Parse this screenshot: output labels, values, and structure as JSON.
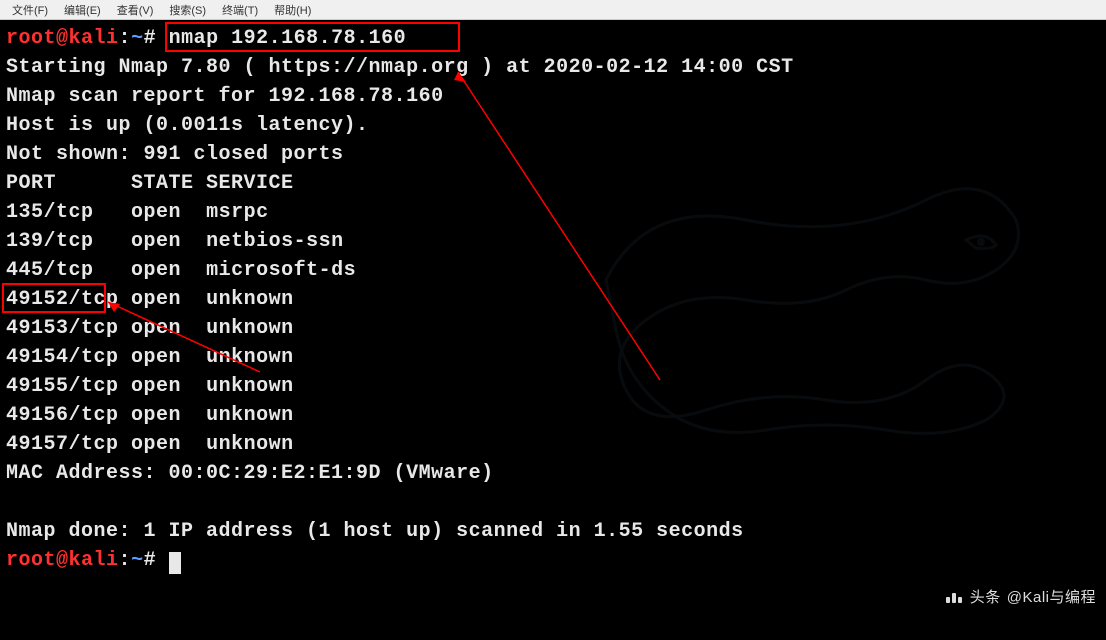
{
  "menubar": {
    "items": [
      {
        "label": "文件(F)"
      },
      {
        "label": "编辑(E)"
      },
      {
        "label": "查看(V)"
      },
      {
        "label": "搜索(S)"
      },
      {
        "label": "终端(T)"
      },
      {
        "label": "帮助(H)"
      }
    ]
  },
  "prompt": {
    "user": "root",
    "at": "@",
    "host": "kali",
    "sep": ":",
    "path": "~",
    "hash": "#"
  },
  "command": "nmap 192.168.78.160",
  "output": {
    "line1": "Starting Nmap 7.80 ( https://nmap.org ) at 2020-02-12 14:00 CST",
    "line2": "Nmap scan report for 192.168.78.160",
    "line3": "Host is up (0.0011s latency).",
    "line4": "Not shown: 991 closed ports",
    "header": "PORT      STATE SERVICE",
    "ports": [
      {
        "port": "135/tcp  ",
        "state": "open ",
        "service": "msrpc"
      },
      {
        "port": "139/tcp  ",
        "state": "open ",
        "service": "netbios-ssn"
      },
      {
        "port": "445/tcp  ",
        "state": "open ",
        "service": "microsoft-ds"
      },
      {
        "port": "49152/tcp",
        "state": "open ",
        "service": "unknown"
      },
      {
        "port": "49153/tcp",
        "state": "open ",
        "service": "unknown"
      },
      {
        "port": "49154/tcp",
        "state": "open ",
        "service": "unknown"
      },
      {
        "port": "49155/tcp",
        "state": "open ",
        "service": "unknown"
      },
      {
        "port": "49156/tcp",
        "state": "open ",
        "service": "unknown"
      },
      {
        "port": "49157/tcp",
        "state": "open ",
        "service": "unknown"
      }
    ],
    "mac": "MAC Address: 00:0C:29:E2:E1:9D (VMware)",
    "blank": " ",
    "done": "Nmap done: 1 IP address (1 host up) scanned in 1.55 seconds"
  },
  "watermark": {
    "prefix": "头条",
    "handle": "@Kali与编程"
  }
}
